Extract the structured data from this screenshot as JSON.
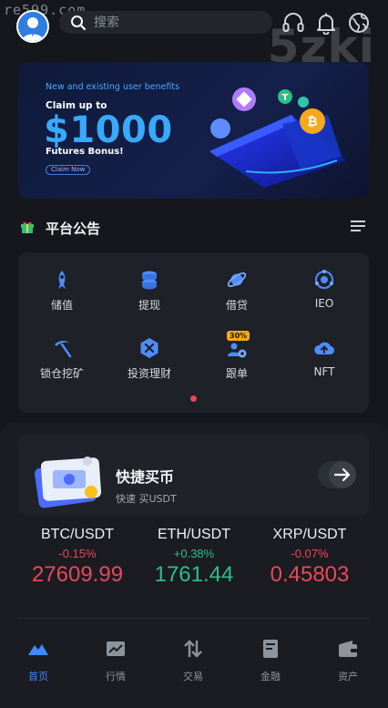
{
  "watermark": {
    "site": "re599.com",
    "logo": "5zki"
  },
  "header": {
    "search_placeholder": "搜索"
  },
  "banner": {
    "subtitle": "New and existing user benefits",
    "claim": "Claim up to",
    "amount": "$1000",
    "bonus": "Futures Bonus!",
    "button": "Claim Now"
  },
  "announcement": {
    "title": "平台公告"
  },
  "grid": {
    "items": [
      {
        "label": "储值",
        "icon": "rocket-icon"
      },
      {
        "label": "提现",
        "icon": "coins-stack-icon"
      },
      {
        "label": "借贷",
        "icon": "planet-icon"
      },
      {
        "label": "IEO",
        "icon": "target-icon"
      },
      {
        "label": "锁仓挖矿",
        "icon": "pickaxe-icon"
      },
      {
        "label": "投资理财",
        "icon": "hexagon-x-icon"
      },
      {
        "label": "跟单",
        "icon": "copy-trade-icon",
        "badge": "30%"
      },
      {
        "label": "NFT",
        "icon": "cloud-upload-icon"
      }
    ]
  },
  "quick_buy": {
    "title": "快捷买币",
    "subtitle": "快速 买USDT"
  },
  "tickers": [
    {
      "pair": "BTC/USDT",
      "change": "-0.15%",
      "price": "27609.99",
      "direction": "down"
    },
    {
      "pair": "ETH/USDT",
      "change": "+0.38%",
      "price": "1761.44",
      "direction": "up"
    },
    {
      "pair": "XRP/USDT",
      "change": "-0.07%",
      "price": "0.45803",
      "direction": "down"
    }
  ],
  "tabs": [
    {
      "label": "首页",
      "icon": "home-mountain-icon",
      "active": true
    },
    {
      "label": "行情",
      "icon": "chart-icon"
    },
    {
      "label": "交易",
      "icon": "swap-arrows-icon"
    },
    {
      "label": "金融",
      "icon": "wallet-card-icon"
    },
    {
      "label": "资产",
      "icon": "wallet-icon"
    }
  ],
  "colors": {
    "down": "#e9485a",
    "up": "#2ebd85",
    "accent": "#3d8bff",
    "background": "#15171c"
  }
}
